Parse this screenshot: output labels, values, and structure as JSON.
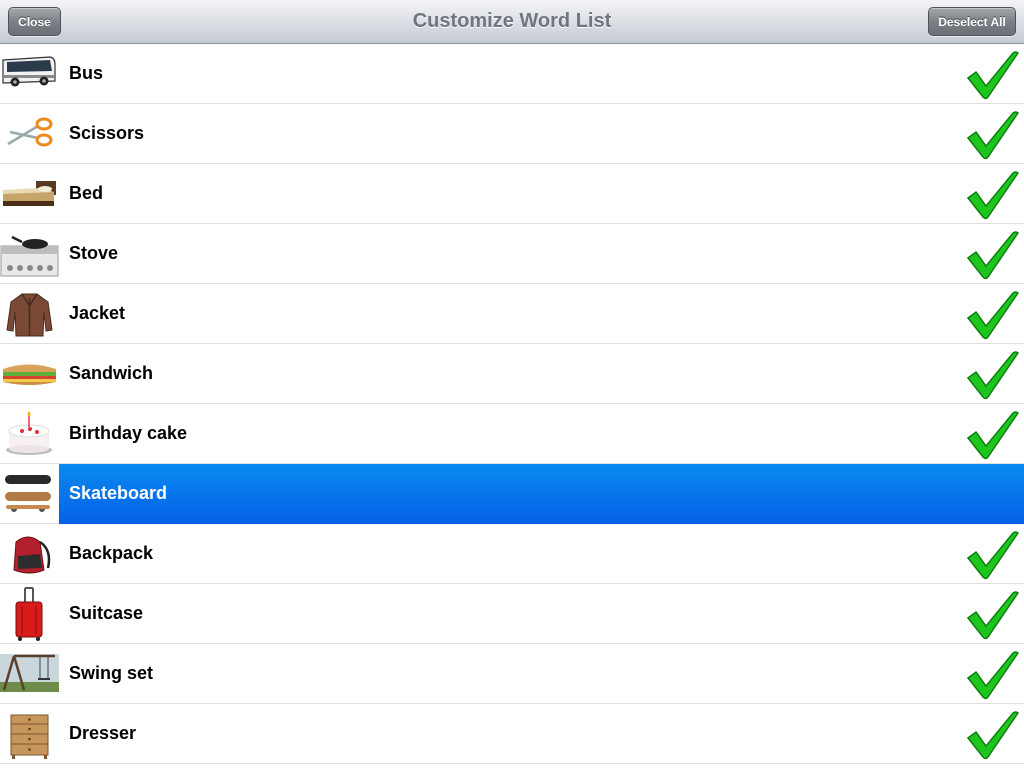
{
  "navbar": {
    "title": "Customize Word List",
    "close_label": "Close",
    "deselect_label": "Deselect All"
  },
  "colors": {
    "selection": "#0a72ec",
    "checkmark": "#22cc22"
  },
  "items": [
    {
      "label": "Bus",
      "icon": "bus-icon",
      "checked": true
    },
    {
      "label": "Scissors",
      "icon": "scissors-icon",
      "checked": true
    },
    {
      "label": "Bed",
      "icon": "bed-icon",
      "checked": true
    },
    {
      "label": "Stove",
      "icon": "stove-icon",
      "checked": true
    },
    {
      "label": "Jacket",
      "icon": "jacket-icon",
      "checked": true
    },
    {
      "label": "Sandwich",
      "icon": "sandwich-icon",
      "checked": true
    },
    {
      "label": "Birthday cake",
      "icon": "birthday-cake-icon",
      "checked": true
    },
    {
      "label": "Skateboard",
      "icon": "skateboard-icon",
      "checked": false,
      "selected": true
    },
    {
      "label": "Backpack",
      "icon": "backpack-icon",
      "checked": true
    },
    {
      "label": "Suitcase",
      "icon": "suitcase-icon",
      "checked": true
    },
    {
      "label": "Swing set",
      "icon": "swing-set-icon",
      "checked": true
    },
    {
      "label": "Dresser",
      "icon": "dresser-icon",
      "checked": true
    }
  ]
}
